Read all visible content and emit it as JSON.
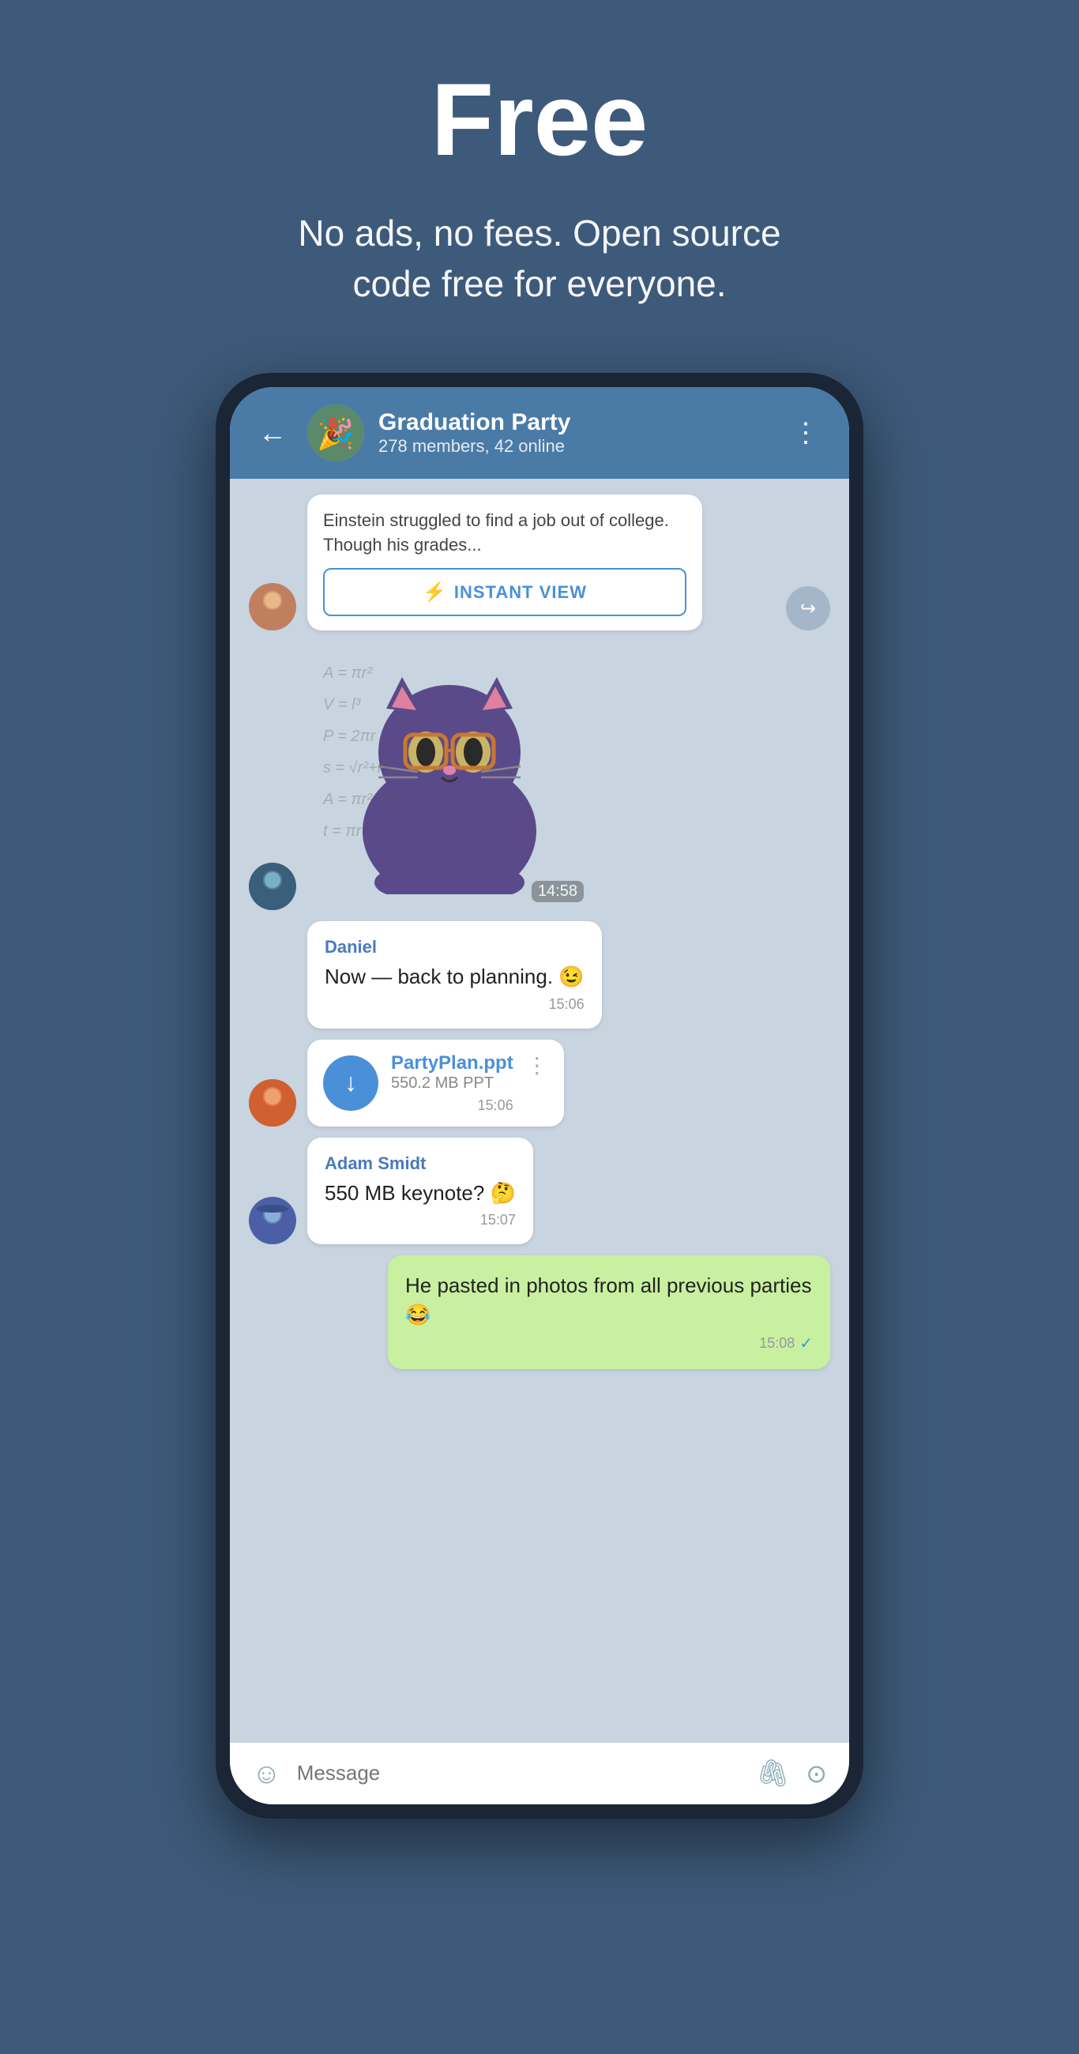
{
  "hero": {
    "title": "Free",
    "subtitle": "No ads, no fees. Open source\ncode free for everyone."
  },
  "chat": {
    "group_name": "Graduation Party",
    "group_members": "278 members, 42 online",
    "back_label": "←",
    "menu_label": "⋮"
  },
  "messages": [
    {
      "id": "msg1",
      "type": "link",
      "sender": "",
      "preview_text": "Einstein struggled to find a job out of college. Though his grades...",
      "instant_view_label": "INSTANT VIEW",
      "avatar_class": "avatar-girl"
    },
    {
      "id": "msg2",
      "type": "sticker",
      "time": "14:58",
      "avatar_class": "avatar-guy1"
    },
    {
      "id": "msg3",
      "type": "text",
      "sender": "Daniel",
      "text": "Now — back to planning. 😉",
      "time": "15:06",
      "avatar_class": ""
    },
    {
      "id": "msg4",
      "type": "file",
      "file_name": "PartyPlan.ppt",
      "file_size": "550.2 MB PPT",
      "time": "15:06",
      "avatar_class": "avatar-guy2"
    },
    {
      "id": "msg5",
      "type": "text",
      "sender": "Adam Smidt",
      "text": "550 MB keynote? 🤔",
      "time": "15:07",
      "avatar_class": "avatar-guy3"
    },
    {
      "id": "msg6",
      "type": "text_green",
      "sender": "",
      "text": "He pasted in photos from all previous parties 😂",
      "time": "15:08",
      "check": "✓"
    }
  ],
  "input": {
    "placeholder": "Message"
  },
  "icons": {
    "back": "←",
    "menu": "⋮",
    "forward": "↪",
    "download": "↓",
    "emoji": "☺",
    "attach": "📎",
    "camera": "⊙",
    "lightning": "⚡",
    "file_menu": "⋮"
  }
}
